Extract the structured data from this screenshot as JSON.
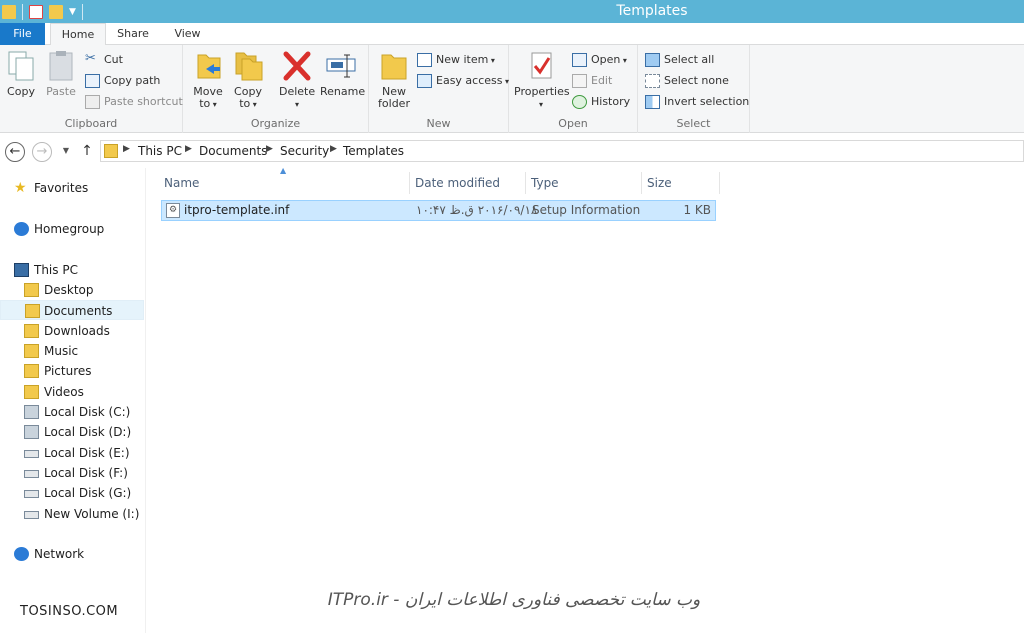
{
  "window": {
    "title": "Templates"
  },
  "ribbon_tabs": {
    "file": "File",
    "home": "Home",
    "share": "Share",
    "view": "View"
  },
  "clipboard": {
    "copy": "Copy",
    "paste": "Paste",
    "cut": "Cut",
    "copy_path": "Copy path",
    "paste_shortcut": "Paste shortcut",
    "label": "Clipboard"
  },
  "organize": {
    "move_to_line1": "Move",
    "move_to_line2": "to",
    "copy_to_line1": "Copy",
    "copy_to_line2": "to",
    "delete": "Delete",
    "rename": "Rename",
    "label": "Organize"
  },
  "new": {
    "new_folder_line1": "New",
    "new_folder_line2": "folder",
    "new_item": "New item",
    "easy_access": "Easy access",
    "label": "New"
  },
  "open": {
    "properties": "Properties",
    "open": "Open",
    "edit": "Edit",
    "history": "History",
    "label": "Open"
  },
  "select": {
    "select_all": "Select all",
    "select_none": "Select none",
    "invert_selection": "Invert selection",
    "label": "Select"
  },
  "breadcrumb": [
    "This PC",
    "Documents",
    "Security",
    "Templates"
  ],
  "nav_pane": {
    "favorites": "Favorites",
    "homegroup": "Homegroup",
    "this_pc": "This PC",
    "items": [
      "Desktop",
      "Documents",
      "Downloads",
      "Music",
      "Pictures",
      "Videos",
      "Local Disk (C:)",
      "Local Disk (D:)",
      "Local Disk (E:)",
      "Local Disk (F:)",
      "Local Disk (G:)",
      "New Volume (I:)"
    ],
    "network": "Network"
  },
  "columns": {
    "name": "Name",
    "date_modified": "Date modified",
    "type": "Type",
    "size": "Size"
  },
  "files": [
    {
      "name": "itpro-template.inf",
      "date_modified": "۲۰۱۶/۰۹/۱۸ ق.ظ ۱۰:۴۷",
      "type": "Setup Information",
      "size": "1 KB"
    }
  ],
  "watermarks": {
    "left": "TOSINSO.COM",
    "center": "ITPro.ir - وب سایت تخصصی فناوری اطلاعات ایران"
  },
  "colors": {
    "titlebar": "#5bb4d6",
    "file_tab": "#1979ca",
    "selection": "#cce8ff"
  }
}
